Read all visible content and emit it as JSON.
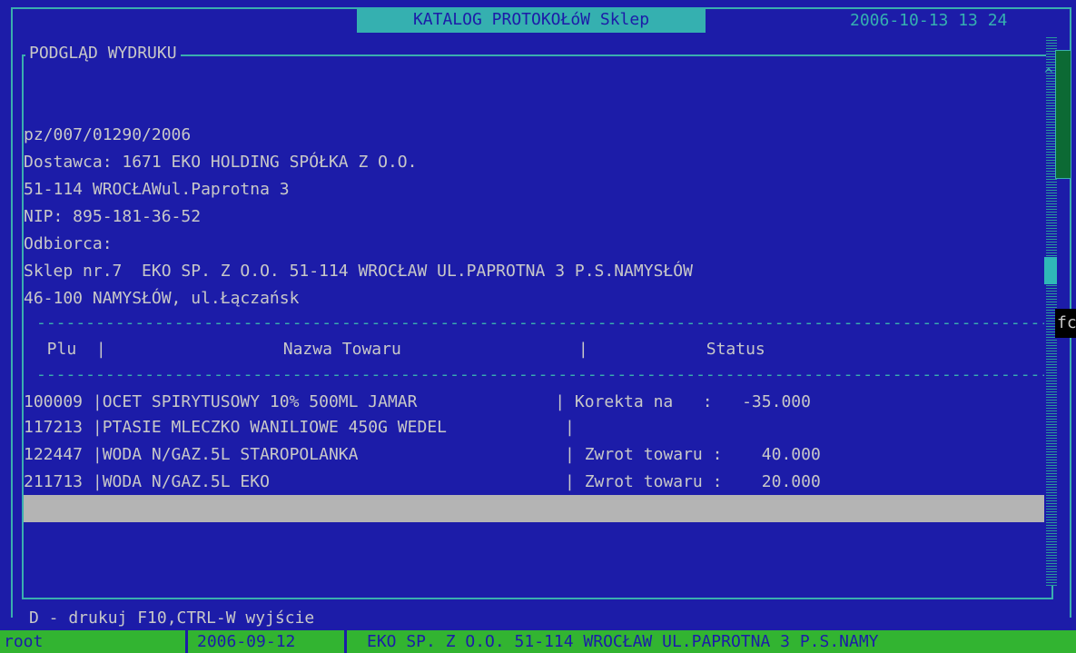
{
  "window": {
    "title": "KATALOG PROTOKOŁóW Sklep",
    "datetime": "2006-10-13 13 24"
  },
  "panel": {
    "title": "PODGLĄD WYDRUKU"
  },
  "document": {
    "lines": [
      "pz/007/01290/2006",
      "Dostawca: 1671 EKO HOLDING SPÓŁKA Z O.O.",
      "51-114 WROCŁAWul.Paprotna 3",
      "NIP: 895-181-36-52",
      "Odbiorca:",
      "Sklep nr.7  EKO SP. Z O.O. 51-114 WROCŁAW UL.PAPROTNA 3 P.S.NAMYSŁÓW",
      "46-100 NAMYSŁÓW, ul.Łączańsk"
    ],
    "separator": "----------------------------------------------------------------------------------------------------------",
    "header": "  Plu  |                  Nazwa Towaru                  |            Status",
    "rows": [
      "100009 |OCET SPIRYTUSOWY 10% 500ML JAMAR              | Korekta na   :   -35.000",
      "117213 |PTASIE MLECZKO WANILIOWE 450G WEDEL            |",
      "122447 |WODA N/GAZ.5L STAROPOLANKA                     | Zwrot towaru :    40.000",
      "211713 |WODA N/GAZ.5L EKO                              | Zwrot towaru :    20.000"
    ]
  },
  "side_label": "fc",
  "help": "D - drukuj  F10,CTRL-W wyjście",
  "status_bar": {
    "user": "root",
    "date": "2006-09-12",
    "shop": "EKO SP. Z O.O. 51-114 WROCŁAW UL.PAPROTNA 3 P.S.NAMY"
  },
  "colors": {
    "background": "#1c1ca8",
    "frame": "#3aaeae",
    "title_bg": "#35b0b0",
    "status_bg": "#32b431",
    "selection": "#b4b4b4"
  }
}
